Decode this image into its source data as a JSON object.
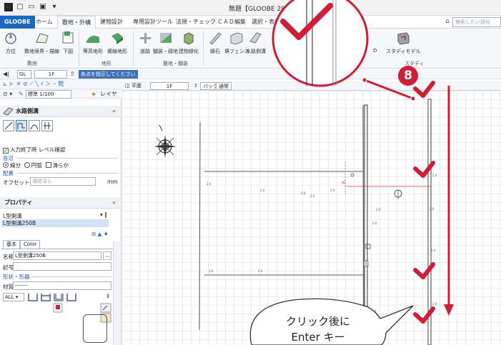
{
  "window": {
    "title": "無題【GLOOBE 2023",
    "app_logo": "G"
  },
  "tabs": {
    "app": "GLOOBE",
    "items": [
      "ホーム",
      "敷地・外構",
      "建物設計",
      "専用設計ツール",
      "法規・チェック",
      "ＣＡＤ編集",
      "選択・表示"
    ],
    "active_index": 1,
    "search_placeholder": "検索したい語句"
  },
  "ribbon": {
    "buttons": [
      "方位",
      "敷地境界・描線",
      "下図",
      "等高地形",
      "複線地形",
      "道路",
      "舗装・緑地",
      "建物緑化",
      "縁石",
      "塀フェンス",
      "水路側溝",
      "D",
      "スタディモデル"
    ],
    "groups": [
      "敷地",
      "地形",
      "整地・舗装",
      "スタディ"
    ]
  },
  "toolbars": {
    "floor": "1F",
    "hint": "各点を指示してください",
    "scale": "標準 1/100",
    "layer": "レイヤ"
  },
  "panel": {
    "tool_title": "水路側溝",
    "confirm_level": "入力終了時 レベル確認",
    "section_edge": "各辺",
    "edge_options": [
      "線分",
      "円弧",
      "滑らか"
    ],
    "section_layout": "配置",
    "offset_label": "オフセット",
    "offset_placeholder": "指定なし",
    "offset_unit": "mm",
    "properties_title": "プロパティ",
    "type_value": "L型側溝",
    "selected_item": "L型側溝250B",
    "tabs": [
      "基本",
      "Color"
    ],
    "name_label": "名称",
    "name_value": "L型側溝250B",
    "symbol_label": "記号",
    "section_shape": "形状・形器",
    "material_label": "材質",
    "material_value": "-------",
    "filter_all": "ALL"
  },
  "canvas_toolbar": {
    "view": "平面",
    "floor": "1F",
    "back": "バック",
    "mode": "通常"
  },
  "canvas_labels": [
    "2.0",
    "2.0",
    "2.0",
    "2.0",
    "2.0",
    "2.0",
    "2.0",
    "2.0",
    "2.0",
    "2.0",
    "2.0",
    "2.0",
    "2.0",
    "2.0"
  ],
  "annotation": {
    "step_number": "8",
    "callout_line1": "クリック後に",
    "callout_line2": "Enter キー"
  },
  "colors": {
    "accent_red": "#cf1e35",
    "app_blue": "#1769c2",
    "selection_blue": "#cfe3fb"
  }
}
